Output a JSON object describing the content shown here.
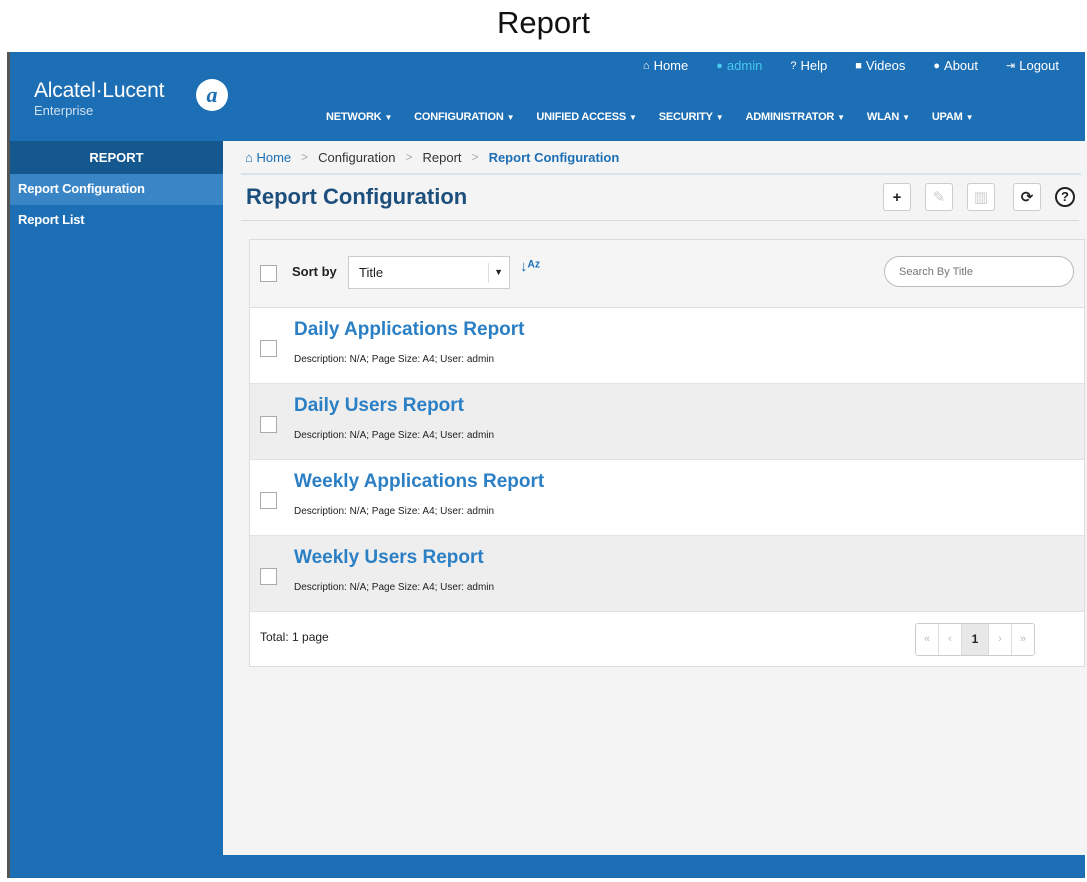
{
  "caption": "Report",
  "colors": {
    "brand": "#1d6fb5",
    "brand_dark": "#15578f",
    "link": "#2b7fc4",
    "admin": "#47c9ef"
  },
  "header": {
    "brand": "Alcatel·Lucent",
    "brand_sub": "Enterprise",
    "logo_mark": "a",
    "top_nav": [
      {
        "icon": "home-icon",
        "glyph": "⌂",
        "label": "Home"
      },
      {
        "icon": "user-icon",
        "glyph": "●",
        "label": "admin"
      },
      {
        "icon": "help-icon",
        "glyph": "?",
        "label": "Help"
      },
      {
        "icon": "video-icon",
        "glyph": "■",
        "label": "Videos"
      },
      {
        "icon": "info-icon",
        "glyph": "●",
        "label": "About"
      },
      {
        "icon": "logout-icon",
        "glyph": "⇥",
        "label": "Logout"
      }
    ],
    "main_nav": [
      "NETWORK",
      "CONFIGURATION",
      "UNIFIED ACCESS",
      "SECURITY",
      "ADMINISTRATOR",
      "WLAN",
      "UPAM"
    ]
  },
  "sidebar": {
    "title": "REPORT",
    "items": [
      {
        "label": "Report Configuration",
        "active": true
      },
      {
        "label": "Report List",
        "active": false
      }
    ]
  },
  "breadcrumb": {
    "home_icon": "home-icon",
    "items": [
      "Home",
      "Configuration",
      "Report",
      "Report Configuration"
    ]
  },
  "page": {
    "title": "Report Configuration"
  },
  "toolbar": {
    "add_icon": "plus-icon",
    "edit_icon": "edit-icon",
    "delete_icon": "trash-icon",
    "refresh_icon": "refresh-icon",
    "help_label": "?"
  },
  "list": {
    "sort_label": "Sort by",
    "sort_value": "Title",
    "search_placeholder": "Search By Title",
    "rows": [
      {
        "title": "Daily Applications Report",
        "desc": "Description: N/A; Page Size: A4; User: admin"
      },
      {
        "title": "Daily Users Report",
        "desc": "Description: N/A; Page Size: A4; User: admin"
      },
      {
        "title": "Weekly Applications Report",
        "desc": "Description: N/A; Page Size: A4; User: admin"
      },
      {
        "title": "Weekly Users Report",
        "desc": "Description: N/A; Page Size: A4; User: admin"
      }
    ],
    "total": "Total: 1 page",
    "pager": {
      "first": "«",
      "prev": "‹",
      "current": "1",
      "next": "›",
      "last": "»"
    }
  }
}
